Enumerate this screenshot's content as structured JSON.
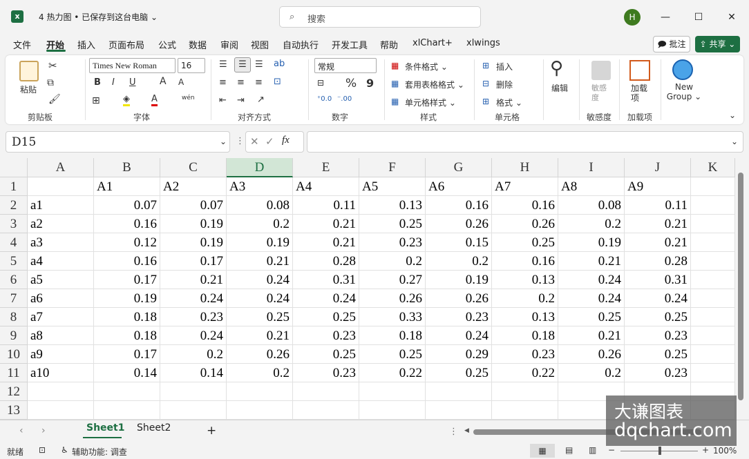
{
  "app": {
    "icon": "excel-icon",
    "title": "4 热力图 • 已保存到这台电脑 ⌄"
  },
  "search": {
    "placeholder": "搜索"
  },
  "user": {
    "initial": "H"
  },
  "window": {
    "minimize": "—",
    "maximize": "☐",
    "close": "✕"
  },
  "menu": [
    "文件",
    "开始",
    "插入",
    "页面布局",
    "公式",
    "数据",
    "审阅",
    "视图",
    "自动执行",
    "开发工具",
    "帮助",
    "xlChart+",
    "xlwings"
  ],
  "actions": {
    "comment": "🗩 批注",
    "share": "⇪ 共享 ⌄"
  },
  "ribbon": {
    "clipboard": {
      "paste": "粘贴",
      "group": "剪贴板"
    },
    "font": {
      "name": "Times New Roman",
      "size": "16",
      "bold": "B",
      "italic": "I",
      "underline": "U",
      "grow": "A",
      "shrink": "A",
      "phonetic": "wén",
      "group": "字体"
    },
    "align": {
      "group": "对齐方式"
    },
    "number": {
      "format": "常规",
      "percent": "%",
      "comma": "9",
      "group": "数字"
    },
    "styles": {
      "conditional": "条件格式 ⌄",
      "table": "套用表格格式 ⌄",
      "cell": "单元格样式 ⌄",
      "group": "样式"
    },
    "cells": {
      "insert": "插入",
      "delete": "删除",
      "format": "格式 ⌄",
      "group": "单元格"
    },
    "editing": {
      "label": "编辑"
    },
    "sensitivity": {
      "label": "敏感度",
      "group": "敏感度"
    },
    "addins": {
      "label": "加载项",
      "group": "加载项"
    },
    "newgroup": {
      "label": "New Group ⌄"
    }
  },
  "formula": {
    "namebox": "D15",
    "fx": "fx",
    "value": ""
  },
  "grid": {
    "columns": [
      "A",
      "B",
      "C",
      "D",
      "E",
      "F",
      "G",
      "H",
      "I",
      "J",
      "K"
    ],
    "selected_column": "D",
    "rows": [
      [
        "",
        "A1",
        "A2",
        "A3",
        "A4",
        "A5",
        "A6",
        "A7",
        "A8",
        "A9"
      ],
      [
        "a1",
        "0.07",
        "0.07",
        "0.08",
        "0.11",
        "0.13",
        "0.16",
        "0.16",
        "0.08",
        "0.11"
      ],
      [
        "a2",
        "0.16",
        "0.19",
        "0.2",
        "0.21",
        "0.25",
        "0.26",
        "0.26",
        "0.2",
        "0.21"
      ],
      [
        "a3",
        "0.12",
        "0.19",
        "0.19",
        "0.21",
        "0.23",
        "0.15",
        "0.25",
        "0.19",
        "0.21"
      ],
      [
        "a4",
        "0.16",
        "0.17",
        "0.21",
        "0.28",
        "0.2",
        "0.2",
        "0.16",
        "0.21",
        "0.28"
      ],
      [
        "a5",
        "0.17",
        "0.21",
        "0.24",
        "0.31",
        "0.27",
        "0.19",
        "0.13",
        "0.24",
        "0.31"
      ],
      [
        "a6",
        "0.19",
        "0.24",
        "0.24",
        "0.24",
        "0.26",
        "0.26",
        "0.2",
        "0.24",
        "0.24"
      ],
      [
        "a7",
        "0.18",
        "0.23",
        "0.25",
        "0.25",
        "0.33",
        "0.23",
        "0.13",
        "0.25",
        "0.25"
      ],
      [
        "a8",
        "0.18",
        "0.24",
        "0.21",
        "0.23",
        "0.18",
        "0.24",
        "0.18",
        "0.21",
        "0.23"
      ],
      [
        "a9",
        "0.17",
        "0.2",
        "0.26",
        "0.25",
        "0.25",
        "0.29",
        "0.23",
        "0.26",
        "0.25"
      ],
      [
        "a10",
        "0.14",
        "0.14",
        "0.2",
        "0.23",
        "0.22",
        "0.25",
        "0.22",
        "0.2",
        "0.23"
      ],
      [
        "",
        "",
        "",
        "",
        "",
        "",
        "",
        "",
        "",
        ""
      ],
      [
        "",
        "",
        "",
        "",
        "",
        "",
        "",
        "",
        "",
        ""
      ]
    ],
    "row_numbers": [
      "1",
      "2",
      "3",
      "4",
      "5",
      "6",
      "7",
      "8",
      "9",
      "10",
      "11",
      "12",
      "13"
    ]
  },
  "sheets": {
    "tabs": [
      "Sheet1",
      "Sheet2"
    ],
    "active": "Sheet1",
    "add": "+"
  },
  "status": {
    "ready": "就绪",
    "accessibility": "辅助功能: 调查",
    "zoom": "100%"
  },
  "watermark": {
    "line1": "大谦图表",
    "line2": "dqchart.com"
  }
}
